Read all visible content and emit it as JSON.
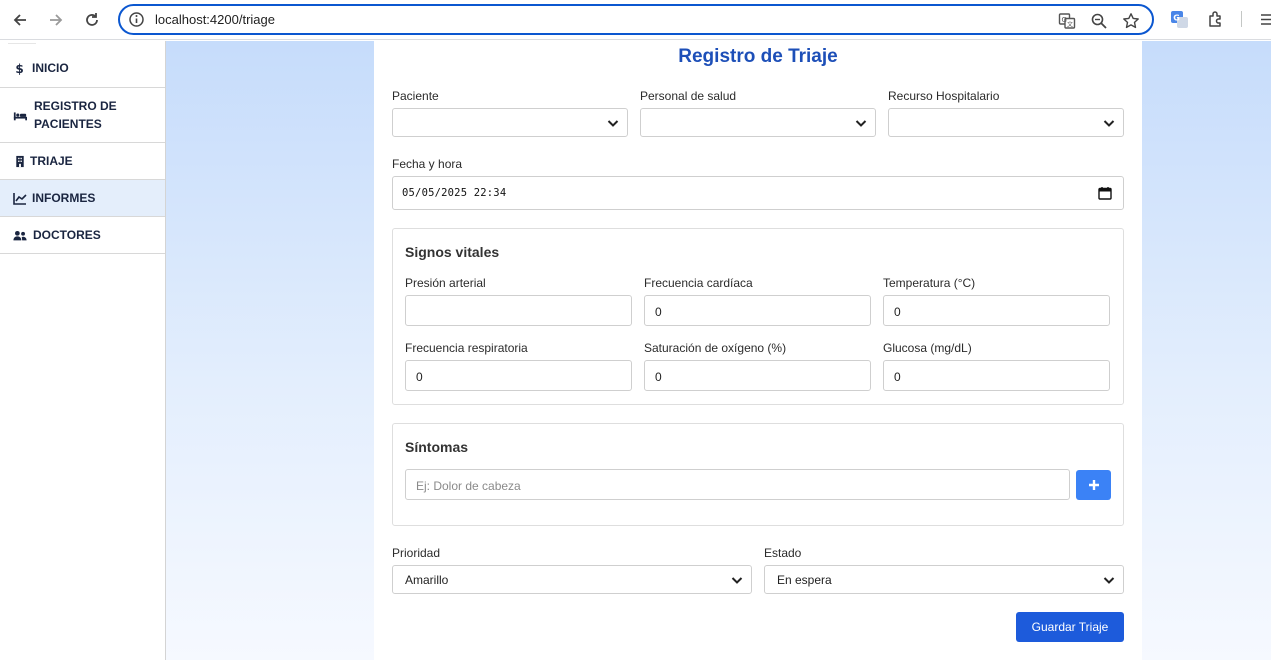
{
  "browser": {
    "url": "localhost:4200/triage"
  },
  "sidebar": {
    "items": [
      {
        "label": "INICIO",
        "icon": "dollar-icon"
      },
      {
        "label": "REGISTRO DE PACIENTES",
        "icon": "bed-icon"
      },
      {
        "label": "TRIAJE",
        "icon": "building-icon"
      },
      {
        "label": "INFORMES",
        "icon": "chart-icon",
        "active": true
      },
      {
        "label": "DOCTORES",
        "icon": "users-icon"
      }
    ]
  },
  "form": {
    "title": "Registro de Triaje",
    "paciente_label": "Paciente",
    "paciente_value": "",
    "personal_label": "Personal de salud",
    "personal_value": "",
    "recurso_label": "Recurso Hospitalario",
    "recurso_value": "",
    "fecha_label": "Fecha y hora",
    "fecha_value": "05/05/2025 22:34",
    "vitals": {
      "title": "Signos vitales",
      "presion_label": "Presión arterial",
      "presion_value": "",
      "fc_label": "Frecuencia cardíaca",
      "fc_value": "0",
      "temp_label": "Temperatura (°C)",
      "temp_value": "0",
      "fr_label": "Frecuencia respiratoria",
      "fr_value": "0",
      "sat_label": "Saturación de oxígeno (%)",
      "sat_value": "0",
      "glucosa_label": "Glucosa (mg/dL)",
      "glucosa_value": "0"
    },
    "sintomas": {
      "title": "Síntomas",
      "placeholder": "Ej: Dolor de cabeza"
    },
    "prioridad_label": "Prioridad",
    "prioridad_value": "Amarillo",
    "estado_label": "Estado",
    "estado_value": "En espera",
    "save_label": "Guardar Triaje"
  },
  "colors": {
    "accent": "#1d5bdb",
    "title": "#1d4fb8",
    "add_button": "#3b82f6"
  }
}
